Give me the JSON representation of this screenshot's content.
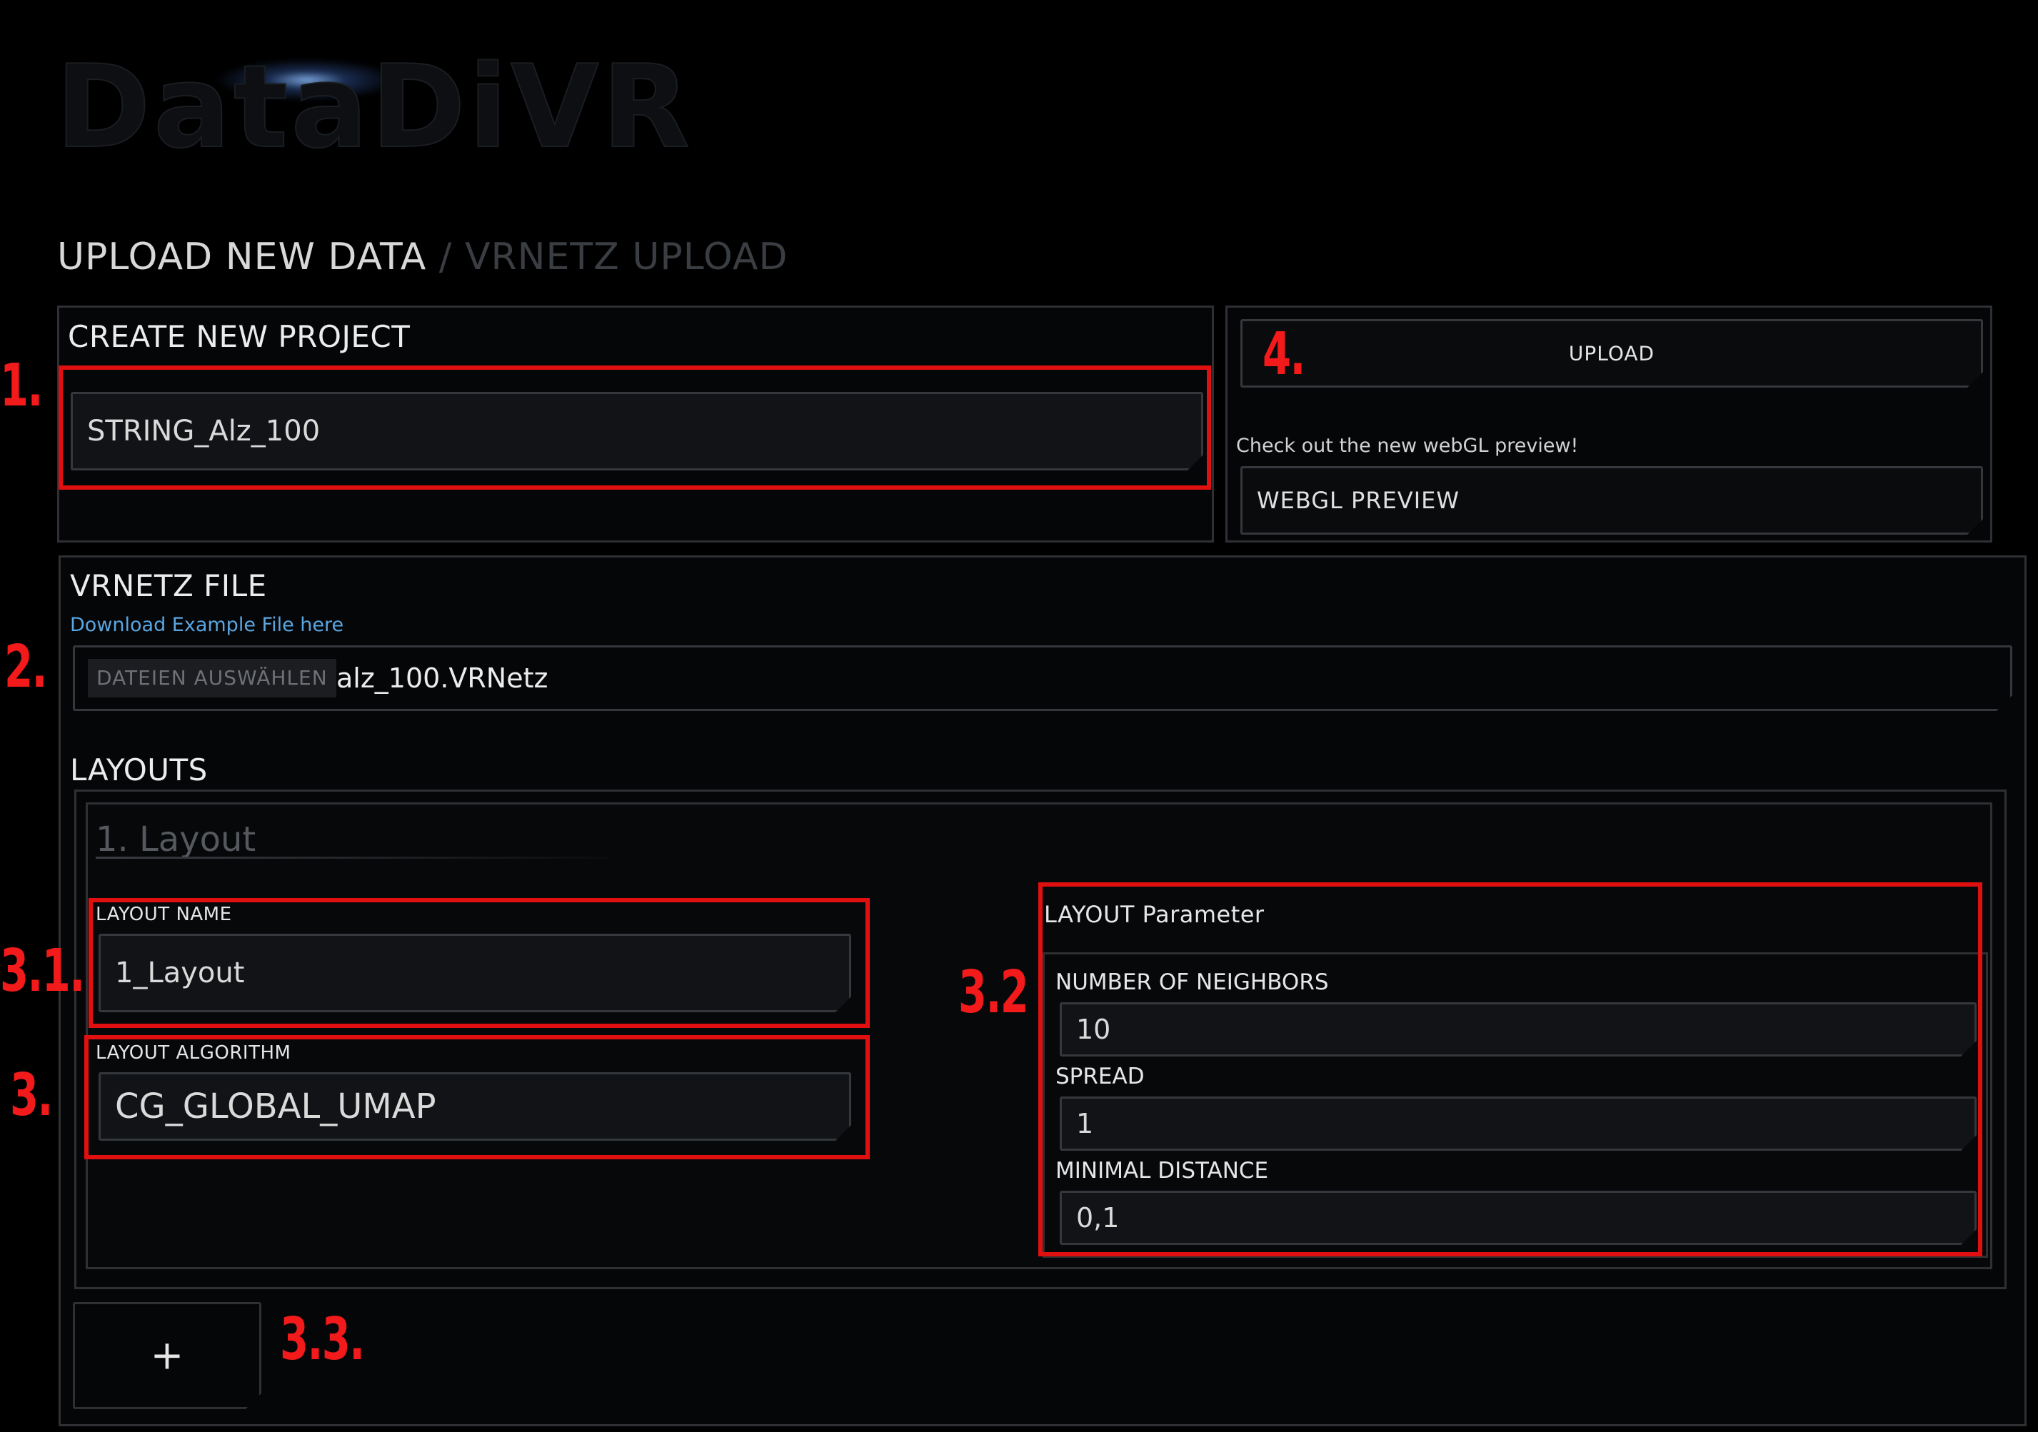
{
  "app": {
    "title": "DataDiVR"
  },
  "breadcrumb": {
    "current": "UPLOAD NEW DATA",
    "separator": "/",
    "section": "VRNETZ UPLOAD"
  },
  "create_project": {
    "title": "CREATE NEW PROJECT",
    "project_name_value": "STRING_Alz_100"
  },
  "upload_panel": {
    "upload_label": "UPLOAD",
    "webgl_note": "Check out the new webGL preview!",
    "webgl_button_label": "WEBGL PREVIEW"
  },
  "vrnetz_file": {
    "title": "VRNETZ FILE",
    "example_link": "Download Example File here",
    "choose_button_label": "DATEIEN AUSWÄHLEN",
    "file_name": "alz_100.VRNetz"
  },
  "layouts": {
    "title": "LAYOUTS",
    "layout1": {
      "heading": "1. Layout",
      "name_label": "LAYOUT NAME",
      "name_value": "1_Layout",
      "algorithm_label": "LAYOUT ALGORITHM",
      "algorithm_value": "CG_GLOBAL_UMAP",
      "params_title": "LAYOUT Parameter",
      "params": [
        {
          "label": "NUMBER OF NEIGHBORS",
          "value": "10"
        },
        {
          "label": "SPREAD",
          "value": "1"
        },
        {
          "label": "MINIMAL DISTANCE",
          "value": "0,1"
        }
      ]
    },
    "add_button_label": "+"
  },
  "annotations": {
    "m1": "1.",
    "m2": "2.",
    "m3": "3.",
    "m31": "3.1.",
    "m32": "3.2",
    "m33": "3.3.",
    "m4": "4."
  },
  "colors": {
    "annotation_red": "#e01010",
    "link_blue": "#5aa6e0",
    "background": "#000000"
  }
}
